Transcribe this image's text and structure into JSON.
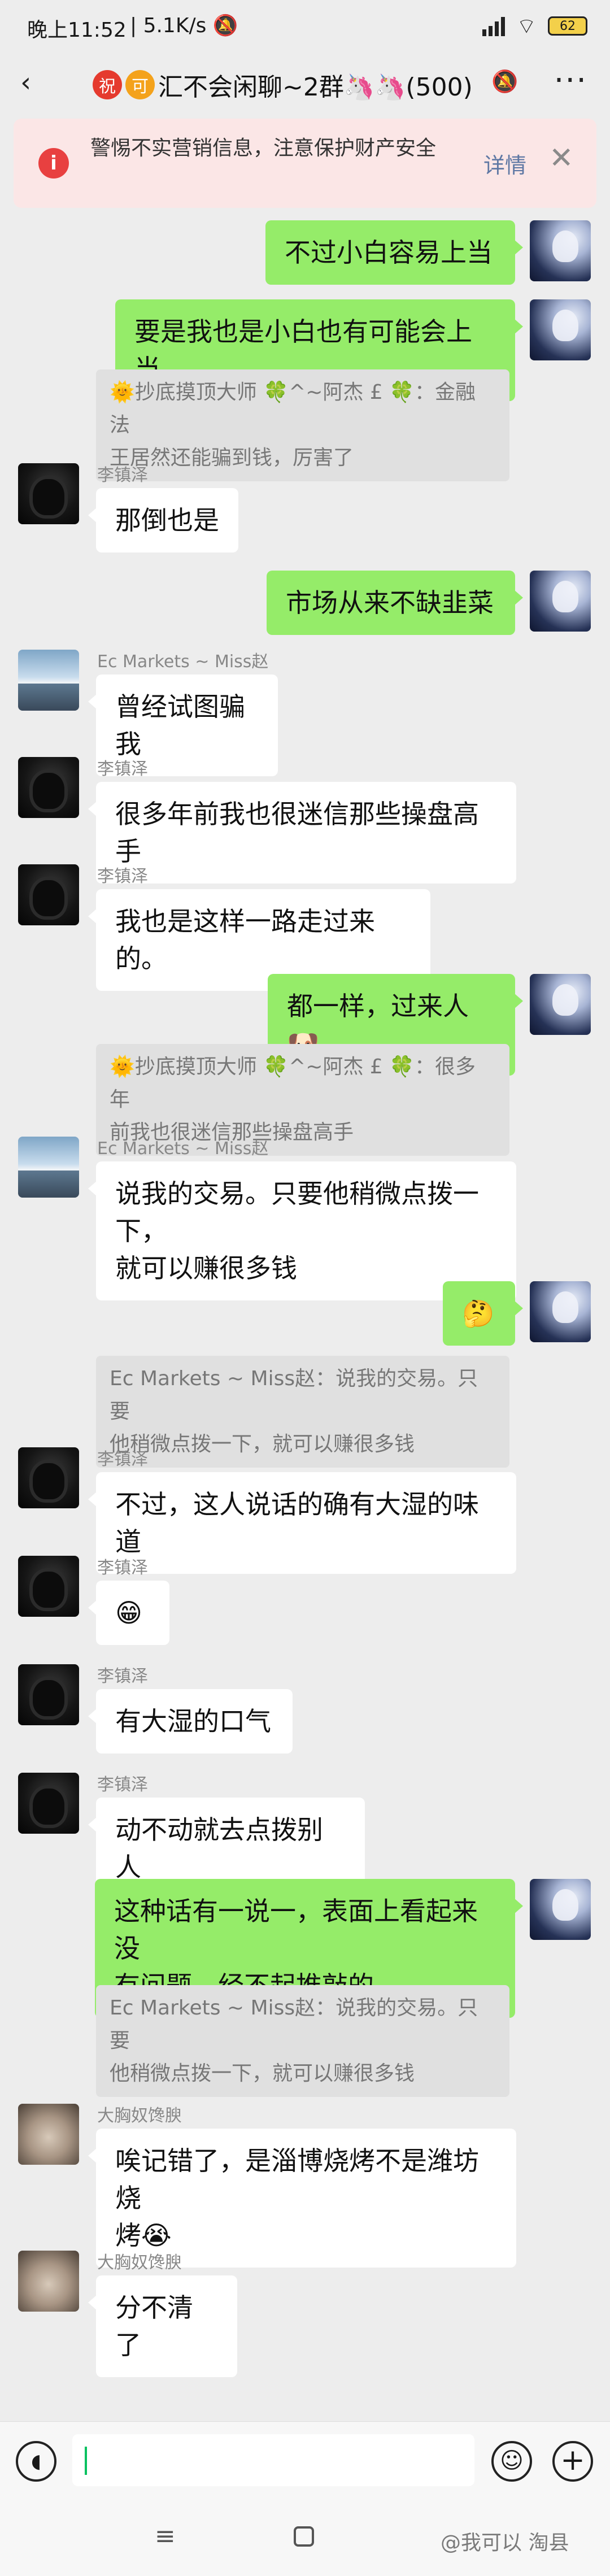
{
  "status": {
    "time": "晚上11:52",
    "speed": "5.1K/s",
    "battery": "62"
  },
  "header": {
    "back_icon": "‹",
    "badge1": "祝",
    "badge2": "可",
    "title": "汇不会闲聊~2群🦄🦄(500)",
    "more_icon": "···"
  },
  "warning": {
    "text": "警惕不实营销信息，注意保护财产安全",
    "detail": "详情",
    "close": "✕"
  },
  "messages": [
    {
      "side": "right",
      "text": "不过小白容易上当"
    },
    {
      "side": "right",
      "text": "要是我也是小白也有可能会上当"
    },
    {
      "quote": "🌞抄底摸顶大师 🍀^~阿杰 £ 🍀：金融法\n王居然还能骗到钱，厉害了"
    },
    {
      "side": "left",
      "sender": "李镇泽",
      "avatar": "ljz",
      "text": "那倒也是"
    },
    {
      "side": "right",
      "text": "市场从来不缺韭菜"
    },
    {
      "side": "left",
      "sender": "Ec Markets ~ Miss赵",
      "avatar": "ec",
      "text": "曾经试图骗我"
    },
    {
      "side": "left",
      "sender": "李镇泽",
      "avatar": "ljz",
      "text": "很多年前我也很迷信那些操盘高手"
    },
    {
      "side": "left",
      "sender": "李镇泽",
      "avatar": "ljz",
      "text": "我也是这样一路走过来的。"
    },
    {
      "side": "right",
      "text": "都一样，过来人🐶"
    },
    {
      "quote": "🌞抄底摸顶大师 🍀^~阿杰 £ 🍀：很多年\n前我也很迷信那些操盘高手"
    },
    {
      "side": "left",
      "sender": "Ec Markets ~ Miss赵",
      "avatar": "ec",
      "text": "说我的交易。只要他稍微点拨一下，\n就可以赚很多钱"
    },
    {
      "side": "right",
      "text": "🤔"
    },
    {
      "quote": "Ec Markets ~ Miss赵：说我的交易。只要\n他稍微点拨一下，就可以赚很多钱"
    },
    {
      "side": "left",
      "sender": "李镇泽",
      "avatar": "ljz",
      "text": "不过，这人说话的确有大湿的味道"
    },
    {
      "side": "left",
      "sender": "李镇泽",
      "avatar": "ljz",
      "text": "😁"
    },
    {
      "side": "left",
      "sender": "李镇泽",
      "avatar": "ljz",
      "text": "有大湿的口气"
    },
    {
      "side": "left",
      "sender": "李镇泽",
      "avatar": "ljz",
      "text": "动不动就去点拨别人"
    },
    {
      "side": "right",
      "text": "这种话有一说一，表面上看起来没\n有问题，经不起推敲的"
    },
    {
      "quote": "Ec Markets ~ Miss赵：说我的交易。只要\n他稍微点拨一下，就可以赚很多钱"
    },
    {
      "side": "left",
      "sender": "大胸奴馋腴",
      "avatar": "dx",
      "text": "唉记错了，是淄博烧烤不是潍坊烧\n烤😭"
    },
    {
      "side": "left",
      "sender": "大胸奴馋腴",
      "avatar": "dx",
      "text": "分不清了"
    }
  ],
  "input": {
    "value": ""
  },
  "watermark": "@我可以 淘县"
}
